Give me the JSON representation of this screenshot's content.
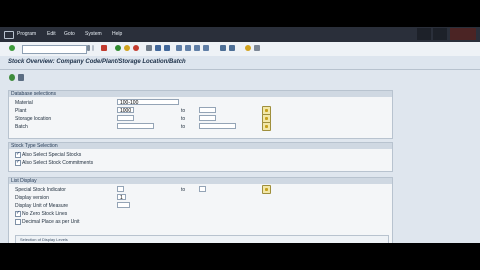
{
  "menu": {
    "items": [
      "Program",
      "Edit",
      "Goto",
      "System",
      "Help"
    ]
  },
  "page": {
    "title": "Stock Overview: Company Code/Plant/Storage Location/Batch"
  },
  "database_selections": {
    "header": "Database selections",
    "material": {
      "label": "Material",
      "value": "100-100"
    },
    "plant": {
      "label": "Plant",
      "value": "1000",
      "to_label": "to"
    },
    "storage_location": {
      "label": "Storage location",
      "value": "",
      "to_label": "to"
    },
    "batch": {
      "label": "Batch",
      "value": "",
      "to_label": "to"
    }
  },
  "stock_type_selection": {
    "header": "Stock Type Selection",
    "special_stocks": {
      "label": "Also Select Special Stocks",
      "checked": true
    },
    "stock_commitments": {
      "label": "Also Select Stock Commitments",
      "checked": true
    }
  },
  "list_display": {
    "header": "List Display",
    "special_stock_indicator": {
      "label": "Special Stock Indicator",
      "value": "",
      "to_label": "to"
    },
    "display_version": {
      "label": "Display version",
      "value": "1"
    },
    "display_unit": {
      "label": "Display Unit of Measure",
      "value": ""
    },
    "no_zero_stock": {
      "label": "No Zero Stock Lines",
      "checked": true
    },
    "decimal_place": {
      "label": "Decimal Place as per Unit",
      "checked": false
    },
    "selection_display_levels": "Selection of Display Levels"
  }
}
